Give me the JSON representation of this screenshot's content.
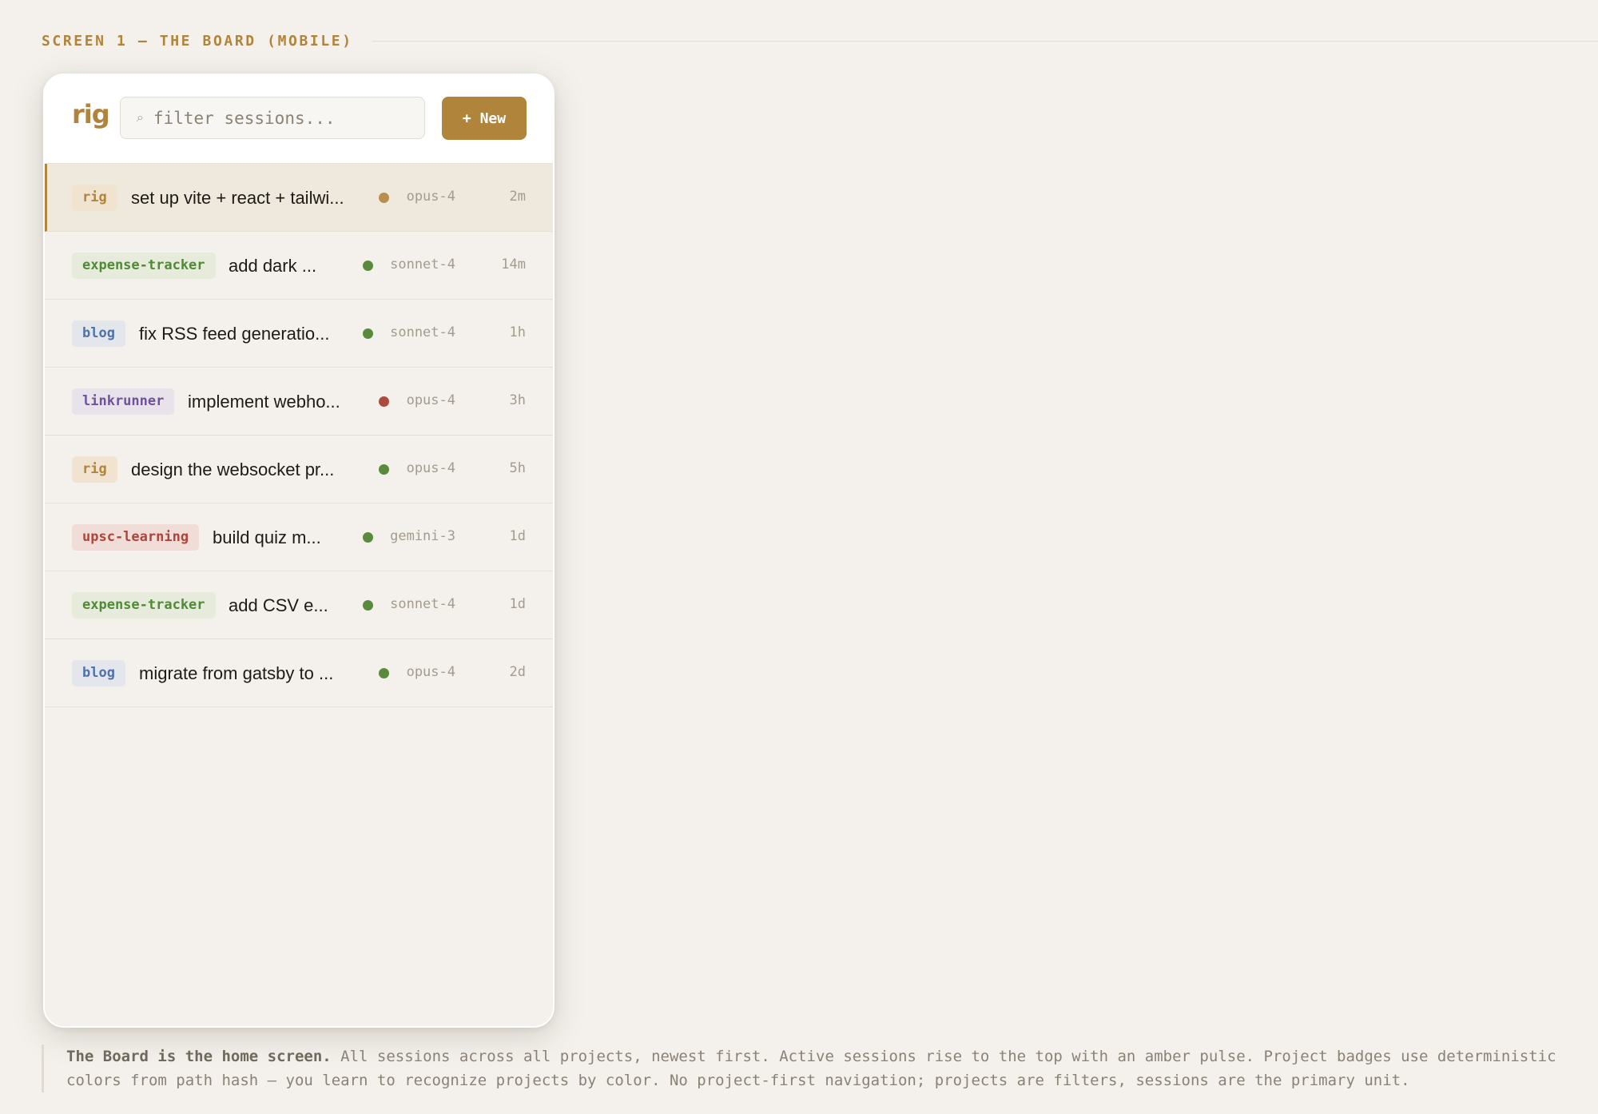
{
  "screen": {
    "label": "SCREEN 1 — THE BOARD (MOBILE)"
  },
  "app": {
    "logo": "rig",
    "search": {
      "placeholder": "filter sessions...",
      "value": ""
    },
    "new_button_label": "+ New"
  },
  "colors": {
    "accent": "#b0843a",
    "status_active": "#b98f4e",
    "status_done": "#5a8a3c",
    "status_error": "#ad4a3f"
  },
  "project_colors": {
    "rig": {
      "text": "#b0843a",
      "bg": "#f0e4d0"
    },
    "expense-tracker": {
      "text": "#4f8a35",
      "bg": "#e6ebdc"
    },
    "blog": {
      "text": "#4f73a8",
      "bg": "#e3e6ea"
    },
    "linkrunner": {
      "text": "#6d5399",
      "bg": "#e8e2ea"
    },
    "upsc-learning": {
      "text": "#b0443a",
      "bg": "#f0ddd8"
    }
  },
  "sessions": [
    {
      "project": "rig",
      "title": "set up vite + react + tailwi...",
      "status": "active",
      "model": "opus-4",
      "age": "2m"
    },
    {
      "project": "expense-tracker",
      "title": "add dark ...",
      "status": "done",
      "model": "sonnet-4",
      "age": "14m"
    },
    {
      "project": "blog",
      "title": "fix RSS feed generatio...",
      "status": "done",
      "model": "sonnet-4",
      "age": "1h"
    },
    {
      "project": "linkrunner",
      "title": "implement webho...",
      "status": "error",
      "model": "opus-4",
      "age": "3h"
    },
    {
      "project": "rig",
      "title": "design the websocket pr...",
      "status": "done",
      "model": "opus-4",
      "age": "5h"
    },
    {
      "project": "upsc-learning",
      "title": "build quiz m...",
      "status": "done",
      "model": "gemini-3",
      "age": "1d"
    },
    {
      "project": "expense-tracker",
      "title": "add CSV e...",
      "status": "done",
      "model": "sonnet-4",
      "age": "1d"
    },
    {
      "project": "blog",
      "title": "migrate from gatsby to ...",
      "status": "done",
      "model": "opus-4",
      "age": "2d"
    }
  ],
  "caption": {
    "lead": "The Board is the home screen.",
    "body": " All sessions across all projects, newest first. Active sessions rise to the top with an amber pulse. Project badges use deterministic colors from path hash — you learn to recognize projects by color. No project-first navigation; projects are filters, sessions are the primary unit."
  }
}
